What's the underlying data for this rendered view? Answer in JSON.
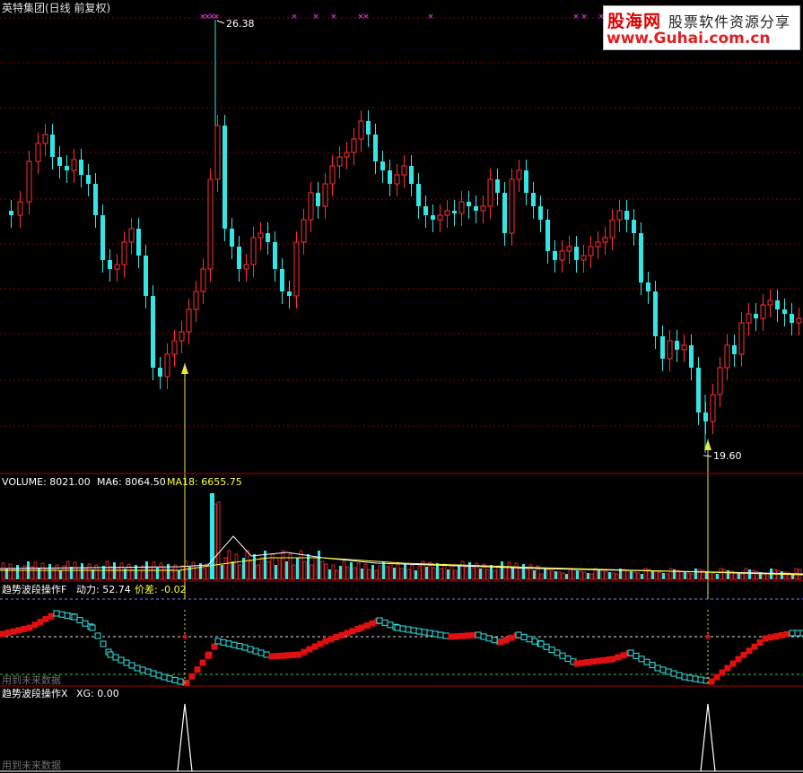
{
  "window": {
    "title": "英特集团(日线 前复权)"
  },
  "watermark": {
    "brand": "股海网",
    "slogan": "股票软件资源分享",
    "url": "www.Guhai.com.cn"
  },
  "colors": {
    "up": "#ff3030",
    "down": "#33e6e6",
    "grid": "#8a0000",
    "separator": "#b00000",
    "signal": "#e8e840",
    "x_marker": "#ff40ff",
    "text": "#d8d8d8",
    "ma18": "#ffff40"
  },
  "panels": {
    "price": {
      "high_label": "26.38",
      "low_label": "19.60"
    },
    "volume": {
      "label_volume": "VOLUME: 8021.00",
      "label_ma6": "MA6: 8064.50",
      "label_ma18": "MA18: 6655.75"
    },
    "indicator1": {
      "name": "趋势波段操作F",
      "label_power": "动力: 52.74",
      "label_diff": "价差: -0.02",
      "footer": "用到未来数据"
    },
    "indicator2": {
      "name": "趋势波段操作X",
      "label_xg": "XG: 0.00",
      "footer": "用到未来数据"
    }
  },
  "chart_data": {
    "type": "candlestick",
    "price": {
      "high": 26.38,
      "low": 19.6
    },
    "volume": {
      "current": 8021.0,
      "ma6": 8064.5,
      "ma18": 6655.75
    },
    "indicator_f": {
      "power": 52.74,
      "price_diff": -0.02
    },
    "indicator_x": {
      "xg": 0.0
    }
  }
}
